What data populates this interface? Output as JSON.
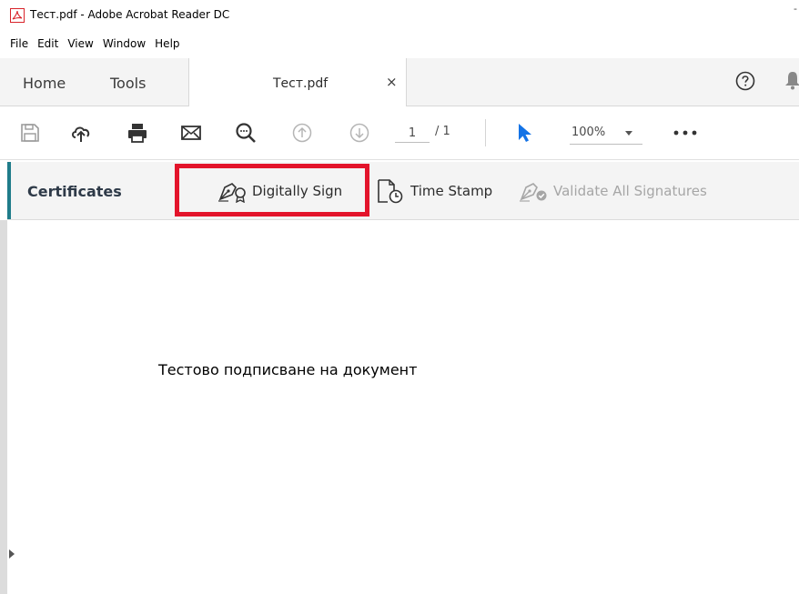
{
  "window": {
    "title": "Тест.pdf - Adobe Acrobat Reader DC",
    "title_dash": "-"
  },
  "menu": [
    "File",
    "Edit",
    "View",
    "Window",
    "Help"
  ],
  "tabs": {
    "home": "Home",
    "tools": "Tools",
    "document": "Тест.pdf",
    "close": "×"
  },
  "toolbar": {
    "page_current": "1",
    "page_total": "/ 1",
    "zoom": "100%"
  },
  "certificates": {
    "title": "Certificates",
    "digitally_sign": "Digitally Sign",
    "time_stamp": "Time Stamp",
    "validate_all": "Validate All Signatures"
  },
  "document": {
    "text": "Тестово подписване на документ"
  },
  "colors": {
    "highlight": "#e3142b",
    "accent": "#1f7c8a",
    "select_tool": "#1473e6",
    "acrobat_red": "#d8232a"
  },
  "icons": [
    "acrobat-icon",
    "help-icon",
    "bell-icon",
    "save-icon",
    "upload-icon",
    "print-icon",
    "mail-icon",
    "find-icon",
    "page-up-icon",
    "page-down-icon",
    "select-arrow-icon",
    "more-icon",
    "digital-sign-icon",
    "time-stamp-icon",
    "validate-signatures-icon"
  ]
}
